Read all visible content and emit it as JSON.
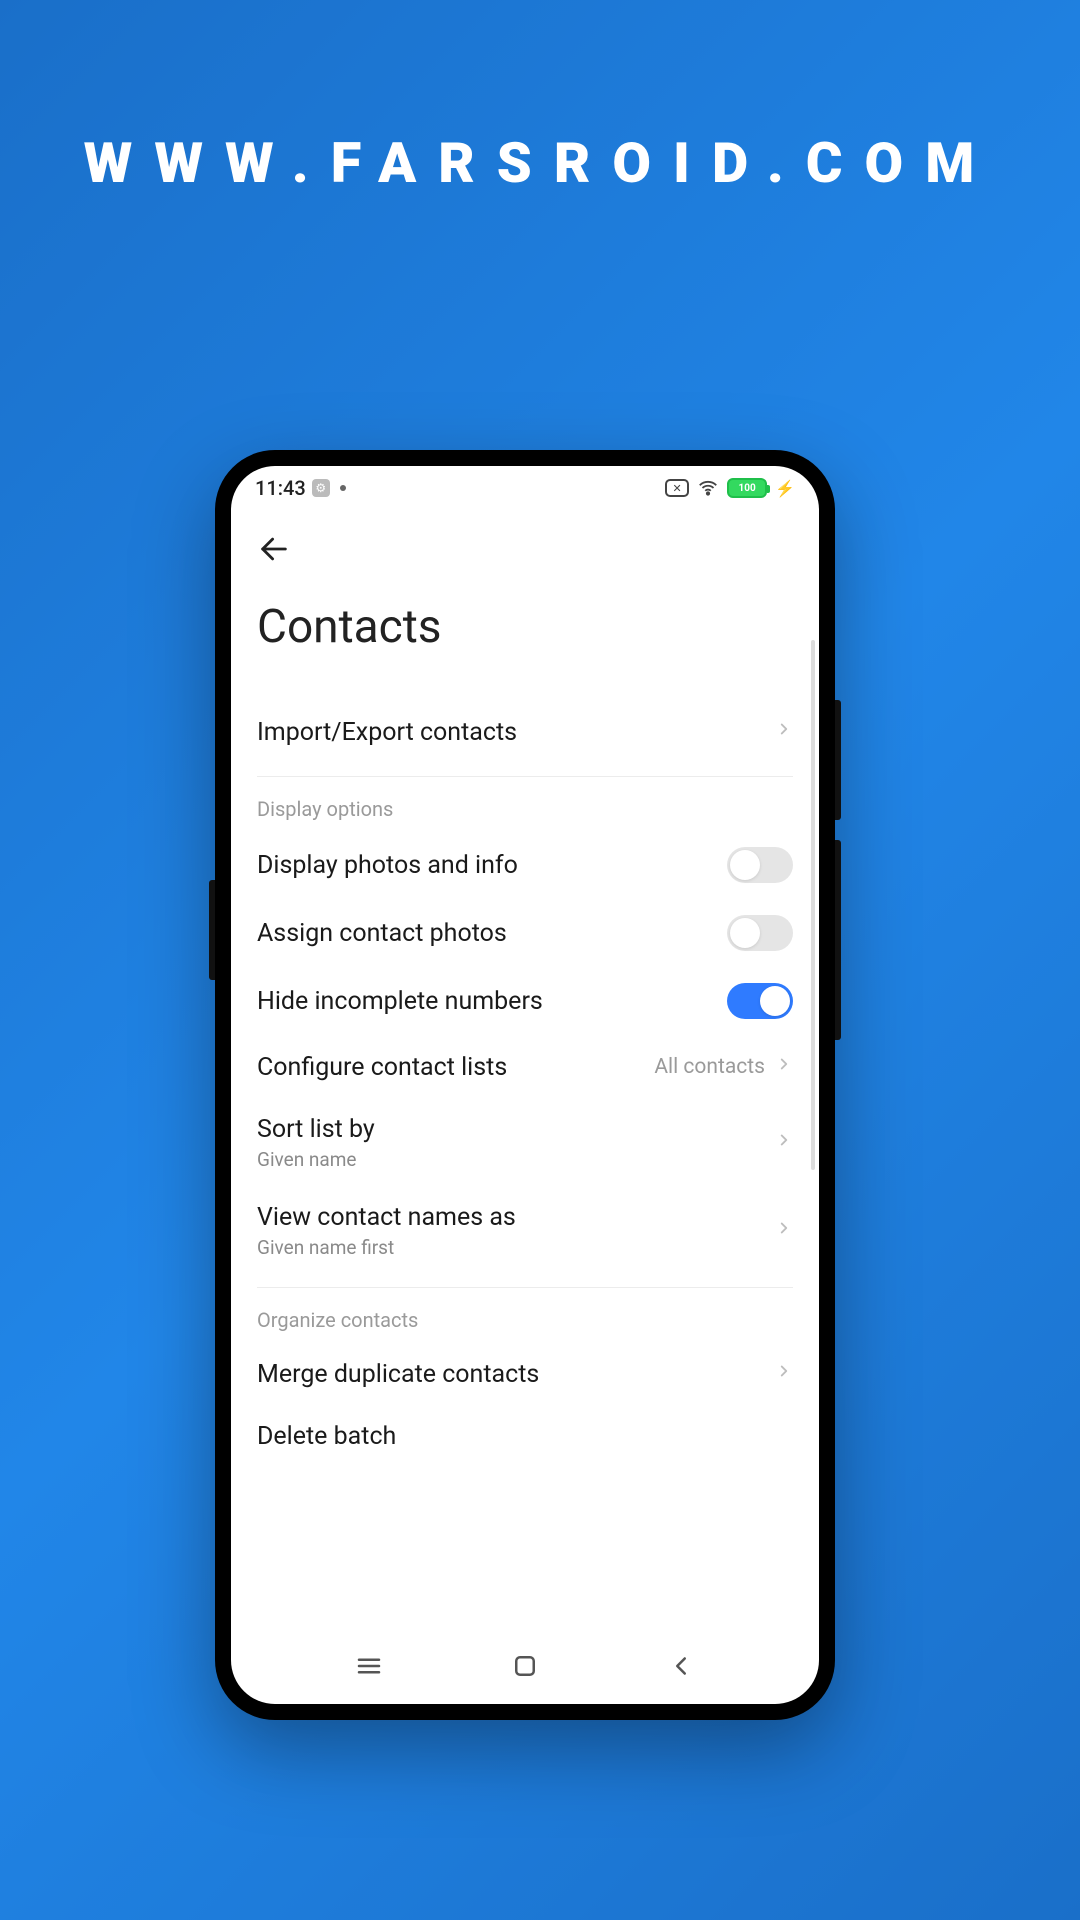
{
  "watermark": "WWW.FARSROID.COM",
  "status": {
    "time": "11:43",
    "battery_text": "100"
  },
  "page": {
    "title": "Contacts"
  },
  "settings": {
    "import_export": {
      "label": "Import/Export contacts"
    },
    "section_display": "Display options",
    "display_photos": {
      "label": "Display photos and info",
      "on": false
    },
    "assign_photos": {
      "label": "Assign contact photos",
      "on": false
    },
    "hide_incomplete": {
      "label": "Hide incomplete numbers",
      "on": true
    },
    "configure_lists": {
      "label": "Configure contact lists",
      "value": "All contacts"
    },
    "sort_by": {
      "label": "Sort list by",
      "value": "Given name"
    },
    "view_names_as": {
      "label": "View contact names as",
      "value": "Given name first"
    },
    "section_organize": "Organize contacts",
    "merge_dup": {
      "label": "Merge duplicate contacts"
    },
    "delete_batch": {
      "label": "Delete batch"
    }
  }
}
